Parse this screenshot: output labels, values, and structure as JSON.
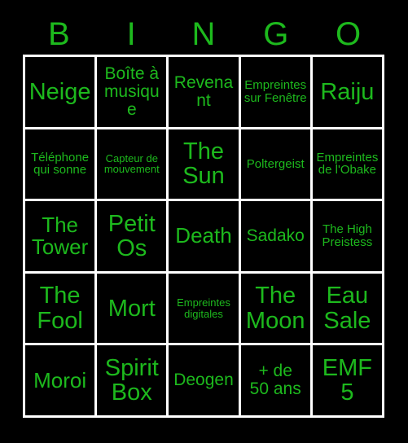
{
  "colors": {
    "background": "#000000",
    "text_green": "#1db91d",
    "grid_line": "#ffffff"
  },
  "header": {
    "letters": [
      "B",
      "I",
      "N",
      "G",
      "O"
    ]
  },
  "grid": {
    "rows": 5,
    "columns": 5,
    "cells": [
      {
        "text": "Neige",
        "size": "xl"
      },
      {
        "text": "Boîte à\nmusique",
        "size": "md"
      },
      {
        "text": "Revenant",
        "size": "md"
      },
      {
        "text": "Empreintes\nsur Fenêtre",
        "size": "sm"
      },
      {
        "text": "Raiju",
        "size": "xl"
      },
      {
        "text": "Téléphone\nqui sonne",
        "size": "sm"
      },
      {
        "text": "Capteur de\nmouvement",
        "size": "xs"
      },
      {
        "text": "The\nSun",
        "size": "xl"
      },
      {
        "text": "Poltergeist",
        "size": "sm"
      },
      {
        "text": "Empreintes\nde l'Obake",
        "size": "sm"
      },
      {
        "text": "The\nTower",
        "size": "lg"
      },
      {
        "text": "Petit\nOs",
        "size": "xl"
      },
      {
        "text": "Death",
        "size": "lg"
      },
      {
        "text": "Sadako",
        "size": "md"
      },
      {
        "text": "The High\nPreistess",
        "size": "sm"
      },
      {
        "text": "The\nFool",
        "size": "xl"
      },
      {
        "text": "Mort",
        "size": "xl"
      },
      {
        "text": "Empreintes\ndigitales",
        "size": "xs"
      },
      {
        "text": "The\nMoon",
        "size": "xl"
      },
      {
        "text": "Eau\nSale",
        "size": "xl"
      },
      {
        "text": "Moroi",
        "size": "lg"
      },
      {
        "text": "Spirit\nBox",
        "size": "xl"
      },
      {
        "text": "Deogen",
        "size": "md"
      },
      {
        "text": "+ de\n50 ans",
        "size": "md"
      },
      {
        "text": "EMF\n5",
        "size": "xl"
      }
    ]
  }
}
